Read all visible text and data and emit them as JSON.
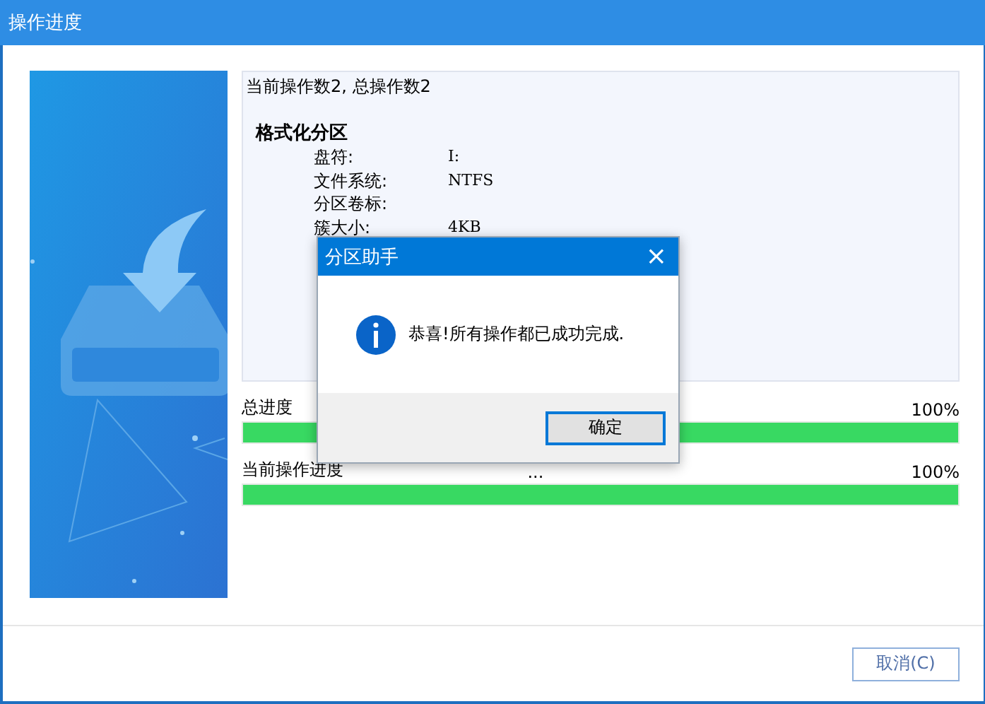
{
  "window": {
    "title": "操作进度"
  },
  "log": {
    "summary": "当前操作数2, 总操作数2",
    "operation": "格式化分区",
    "fields": [
      {
        "label": "盘符:",
        "value": "I:"
      },
      {
        "label": "文件系统:",
        "value": "NTFS"
      },
      {
        "label": "分区卷标:"
      },
      {
        "label": "簇大小:",
        "value": "4KB"
      }
    ]
  },
  "progress": [
    {
      "label": "总进度",
      "reading": "100%",
      "level": 1
    },
    {
      "label": "当前操作进度",
      "status": "...",
      "reading": "100%",
      "level": 1
    }
  ],
  "buttons": {
    "cancel": "取消(C)"
  },
  "dialog": {
    "title": "分区助手",
    "close": "×",
    "message": "恭喜!所有操作都已成功完成.",
    "ok": "确定"
  }
}
